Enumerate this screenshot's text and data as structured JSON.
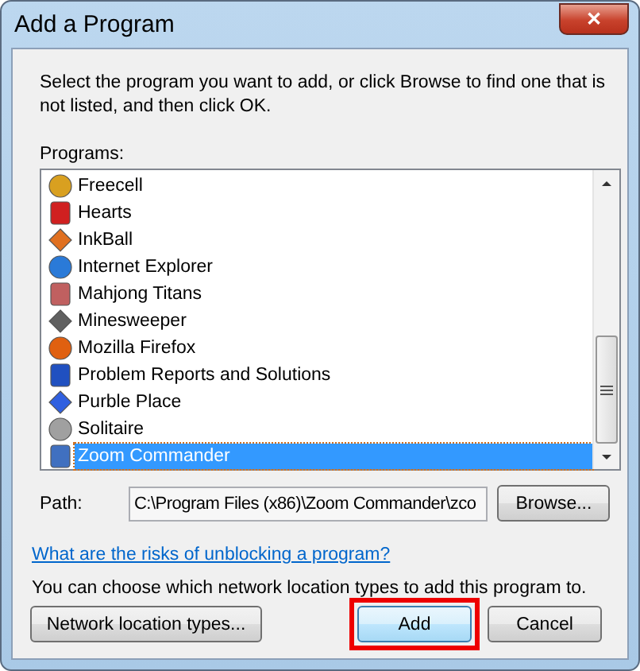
{
  "window": {
    "title": "Add a Program",
    "close": "✕"
  },
  "instructions": "Select the program you want to add, or click Browse to find one that is not listed, and then click OK.",
  "programs_label": "Programs:",
  "programs": [
    {
      "name": "Freecell",
      "selected": false
    },
    {
      "name": "Hearts",
      "selected": false
    },
    {
      "name": "InkBall",
      "selected": false
    },
    {
      "name": "Internet Explorer",
      "selected": false
    },
    {
      "name": "Mahjong Titans",
      "selected": false
    },
    {
      "name": "Minesweeper",
      "selected": false
    },
    {
      "name": "Mozilla Firefox",
      "selected": false
    },
    {
      "name": "Problem Reports and Solutions",
      "selected": false
    },
    {
      "name": "Purble Place",
      "selected": false
    },
    {
      "name": "Solitaire",
      "selected": false
    },
    {
      "name": "Zoom Commander",
      "selected": true
    }
  ],
  "path": {
    "label": "Path:",
    "value": "C:\\Program Files (x86)\\Zoom Commander\\zco",
    "browse": "Browse..."
  },
  "risks_link": "What are the risks of unblocking a program?",
  "network_text": "You can choose which network location types to add this program to.",
  "buttons": [
    {
      "label": "Network location types...",
      "kind": "secondary",
      "highlighted": false
    },
    {
      "label": "Add",
      "kind": "default",
      "highlighted": true
    },
    {
      "label": "Cancel",
      "kind": "secondary",
      "highlighted": false
    }
  ]
}
